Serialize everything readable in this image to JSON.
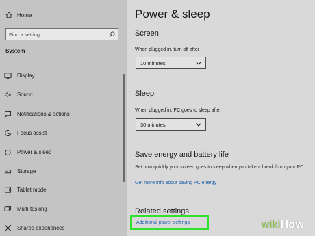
{
  "sidebar": {
    "home_label": "Home",
    "search_placeholder": "Find a setting",
    "section_label": "System",
    "items": [
      {
        "label": "Display",
        "icon": "monitor-icon"
      },
      {
        "label": "Sound",
        "icon": "speaker-icon"
      },
      {
        "label": "Notifications & actions",
        "icon": "notification-icon"
      },
      {
        "label": "Focus assist",
        "icon": "moon-icon"
      },
      {
        "label": "Power & sleep",
        "icon": "power-icon"
      },
      {
        "label": "Storage",
        "icon": "storage-icon"
      },
      {
        "label": "Tablet mode",
        "icon": "tablet-icon"
      },
      {
        "label": "Multi-tasking",
        "icon": "multitasking-icon"
      },
      {
        "label": "Shared experiences",
        "icon": "shared-icon"
      }
    ]
  },
  "content": {
    "title": "Power & sleep",
    "screen": {
      "heading": "Screen",
      "label": "When plugged in, turn off after",
      "value": "10 minutes"
    },
    "sleep": {
      "heading": "Sleep",
      "label": "When plugged in, PC goes to sleep after",
      "value": "30 minutes"
    },
    "energy": {
      "heading": "Save energy and battery life",
      "description": "Set how quickly your screen goes to sleep when you take a break from your PC.",
      "link": "Get more info about saving PC energy"
    },
    "related": {
      "heading": "Related settings",
      "link": "Additional power settings"
    }
  },
  "watermark": {
    "wiki": "wiki",
    "how": "How"
  },
  "colors": {
    "highlight": "#2ee22e",
    "link": "#1b5fa8"
  }
}
